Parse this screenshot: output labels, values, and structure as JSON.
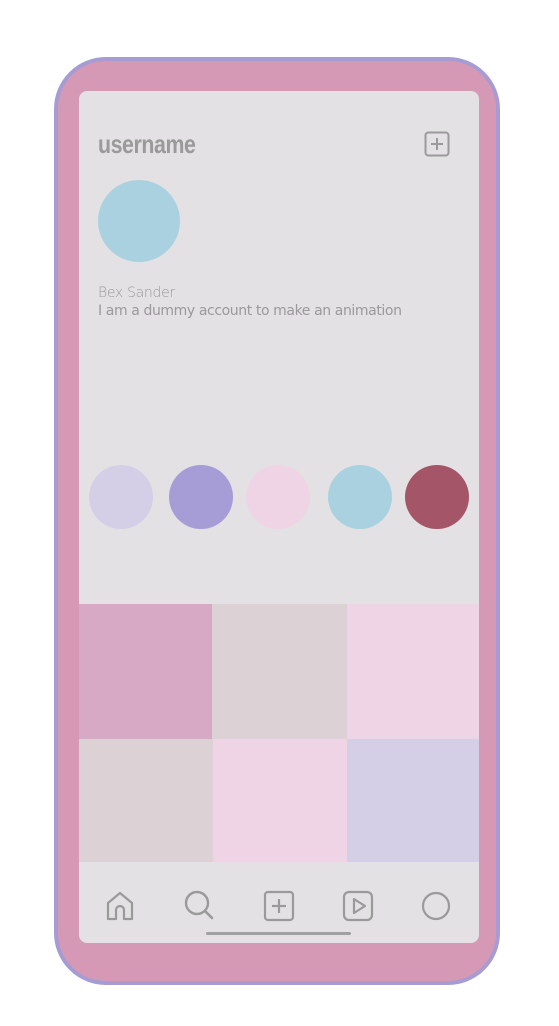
{
  "profile": {
    "username": "username",
    "display_name": "Bex Sander",
    "bio": "I am a dummy account to make an animation"
  },
  "icons": {
    "add_post": "plus-square-icon",
    "nav": [
      "home-icon",
      "search-icon",
      "add-icon",
      "reels-icon",
      "profile-icon"
    ]
  },
  "colors": {
    "frame_fill": "#d699b5",
    "frame_border": "#a69cd3",
    "screen_bg": "#e3e1e3",
    "text_muted": "#9a9a9a",
    "avatar": "#a9d1df"
  },
  "stories": [
    {
      "color": "#d4cfe7"
    },
    {
      "color": "#a69cd6"
    },
    {
      "color": "#efd4e6"
    },
    {
      "color": "#a9d1df"
    },
    {
      "color": "#a45568"
    }
  ],
  "posts": [
    {
      "color": "#d8a9c5"
    },
    {
      "color": "#dcd2d6"
    },
    {
      "color": "#efd4e6"
    },
    {
      "color": "#dcd2d6"
    },
    {
      "color": "#efd4e6"
    },
    {
      "color": "#d4cfe7"
    }
  ]
}
